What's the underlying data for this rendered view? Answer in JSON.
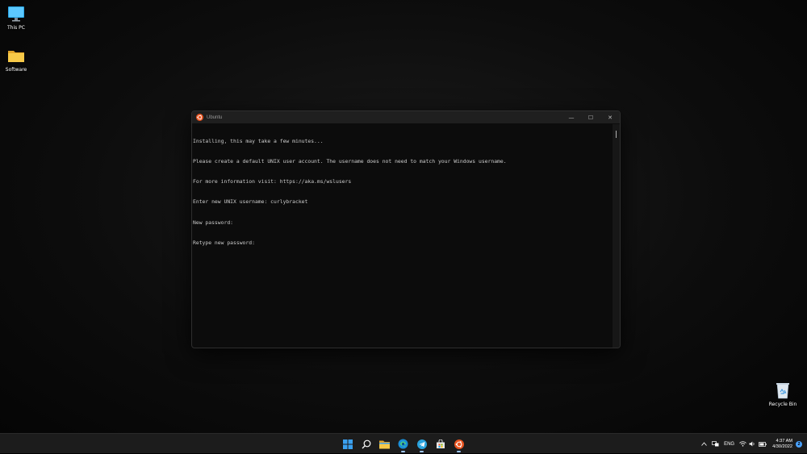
{
  "desktop": {
    "icons": [
      {
        "label": "This PC",
        "icon": "monitor-icon"
      },
      {
        "label": "Software",
        "icon": "folder-icon"
      },
      {
        "label": "Recycle Bin",
        "icon": "recycle-bin-icon"
      }
    ]
  },
  "window": {
    "title": "Ubuntu",
    "controls": {
      "minimize": "—",
      "maximize": "☐",
      "close": "✕"
    },
    "terminal_lines": [
      "Installing, this may take a few minutes...",
      "Please create a default UNIX user account. The username does not need to match your Windows username.",
      "For more information visit: https://aka.ms/wslusers",
      "Enter new UNIX username: curlybracket",
      "New password:",
      "Retype new password:"
    ]
  },
  "taskbar": {
    "apps": [
      {
        "name": "start",
        "icon": "windows-start-icon"
      },
      {
        "name": "search",
        "icon": "search-icon"
      },
      {
        "name": "file-explorer",
        "icon": "folder-icon"
      },
      {
        "name": "edge",
        "icon": "edge-icon"
      },
      {
        "name": "telegram",
        "icon": "telegram-icon"
      },
      {
        "name": "store",
        "icon": "store-icon"
      },
      {
        "name": "ubuntu",
        "icon": "ubuntu-icon"
      }
    ],
    "tray": {
      "language": "ENG",
      "time": "4:37 AM",
      "date": "4/30/2022",
      "notification_count": "2"
    }
  },
  "colors": {
    "ubuntu_orange": "#e95420",
    "accent_blue": "#4aa3ff",
    "folder_yellow": "#f7c948"
  }
}
